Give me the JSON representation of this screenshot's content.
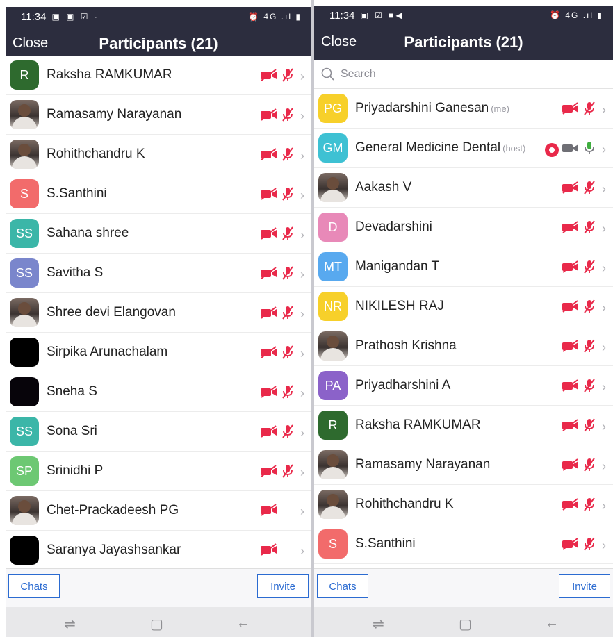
{
  "left_screen": {
    "status": {
      "time": "11:34",
      "left_icons": "▣ ▣ ☑ ·",
      "right_icons": "⏰ 4G .ıl ▮"
    },
    "header": {
      "close": "Close",
      "title": "Participants (21)"
    },
    "participants": [
      {
        "initials": "R",
        "name": "Raksha RAMKUMAR",
        "tag": "",
        "avatar": "#2e6a2e",
        "photo": false,
        "video_off": true,
        "mic": "muted"
      },
      {
        "initials": "",
        "name": "Ramasamy Narayanan",
        "tag": "",
        "avatar": "#000000",
        "photo": true,
        "video_off": true,
        "mic": "muted"
      },
      {
        "initials": "",
        "name": "Rohithchandru K",
        "tag": "",
        "avatar": "#000000",
        "photo": true,
        "video_off": true,
        "mic": "muted"
      },
      {
        "initials": "S",
        "name": "S.Santhini",
        "tag": "",
        "avatar": "#f26b6b",
        "photo": false,
        "video_off": true,
        "mic": "muted"
      },
      {
        "initials": "SS",
        "name": "Sahana shree",
        "tag": "",
        "avatar": "#3bb6a8",
        "photo": false,
        "video_off": true,
        "mic": "muted"
      },
      {
        "initials": "SS",
        "name": "Savitha S",
        "tag": "",
        "avatar": "#7a86cc",
        "photo": false,
        "video_off": true,
        "mic": "muted"
      },
      {
        "initials": "",
        "name": "Shree devi Elangovan",
        "tag": "",
        "avatar": "#000000",
        "photo": true,
        "video_off": true,
        "mic": "muted"
      },
      {
        "initials": "",
        "name": "Sirpika Arunachalam",
        "tag": "",
        "avatar": "#000000",
        "photo": false,
        "video_off": true,
        "mic": "muted"
      },
      {
        "initials": "",
        "name": "Sneha S",
        "tag": "",
        "avatar": "#07040a",
        "photo": false,
        "video_off": true,
        "mic": "muted"
      },
      {
        "initials": "SS",
        "name": "Sona Sri",
        "tag": "",
        "avatar": "#3bb6a8",
        "photo": false,
        "video_off": true,
        "mic": "muted"
      },
      {
        "initials": "SP",
        "name": "Srinidhi P",
        "tag": "",
        "avatar": "#6dc873",
        "photo": false,
        "video_off": true,
        "mic": "muted"
      },
      {
        "initials": "",
        "name": "Chet-Prackadeesh PG",
        "tag": "",
        "avatar": "#000000",
        "photo": true,
        "video_off": true,
        "mic": "none"
      },
      {
        "initials": "",
        "name": "Saranya Jayashsankar",
        "tag": "",
        "avatar": "#000000",
        "photo": false,
        "video_off": true,
        "mic": "none"
      }
    ],
    "footer": {
      "chats": "Chats",
      "invite": "Invite"
    }
  },
  "right_screen": {
    "status": {
      "time": "11:34",
      "left_icons": "▣ ☑ ■◀",
      "right_icons": "⏰ 4G .ıl ▮"
    },
    "header": {
      "close": "Close",
      "title": "Participants (21)"
    },
    "search": {
      "placeholder": "Search"
    },
    "participants": [
      {
        "initials": "PG",
        "name": "Priyadarshini Ganesan",
        "tag": "(me)",
        "avatar": "#f7d02a",
        "photo": false,
        "video_off": true,
        "mic": "muted"
      },
      {
        "initials": "GM",
        "name": "General Medicine Dental",
        "tag": "(host)",
        "avatar": "#3ec1d3",
        "photo": false,
        "video_off": false,
        "mic": "on",
        "recording": true
      },
      {
        "initials": "",
        "name": "Aakash V",
        "tag": "",
        "avatar": "#000000",
        "photo": true,
        "video_off": true,
        "mic": "muted"
      },
      {
        "initials": "D",
        "name": "Devadarshini",
        "tag": "",
        "avatar": "#e889b8",
        "photo": false,
        "video_off": true,
        "mic": "muted"
      },
      {
        "initials": "MT",
        "name": "Manigandan T",
        "tag": "",
        "avatar": "#58a9ef",
        "photo": false,
        "video_off": true,
        "mic": "muted"
      },
      {
        "initials": "NR",
        "name": "NIKILESH RAJ",
        "tag": "",
        "avatar": "#f7d02a",
        "photo": false,
        "video_off": true,
        "mic": "muted"
      },
      {
        "initials": "",
        "name": "Prathosh Krishna",
        "tag": "",
        "avatar": "#000000",
        "photo": true,
        "video_off": true,
        "mic": "muted"
      },
      {
        "initials": "PA",
        "name": "Priyadharshini A",
        "tag": "",
        "avatar": "#8b62c9",
        "photo": false,
        "video_off": true,
        "mic": "muted"
      },
      {
        "initials": "R",
        "name": "Raksha RAMKUMAR",
        "tag": "",
        "avatar": "#2e6a2e",
        "photo": false,
        "video_off": true,
        "mic": "muted"
      },
      {
        "initials": "",
        "name": "Ramasamy Narayanan",
        "tag": "",
        "avatar": "#000000",
        "photo": true,
        "video_off": true,
        "mic": "muted"
      },
      {
        "initials": "",
        "name": "Rohithchandru K",
        "tag": "",
        "avatar": "#000000",
        "photo": true,
        "video_off": true,
        "mic": "muted"
      },
      {
        "initials": "S",
        "name": "S.Santhini",
        "tag": "",
        "avatar": "#f26b6b",
        "photo": false,
        "video_off": true,
        "mic": "muted"
      }
    ],
    "footer": {
      "chats": "Chats",
      "invite": "Invite"
    }
  },
  "colors": {
    "header_bg": "#2c2d3e",
    "muted_red": "#e9294a",
    "accent_blue": "#2b6bd1",
    "mic_on": "#3fae3f"
  },
  "nav": {
    "recents": "recents-icon",
    "home": "home-icon",
    "back": "back-icon"
  }
}
